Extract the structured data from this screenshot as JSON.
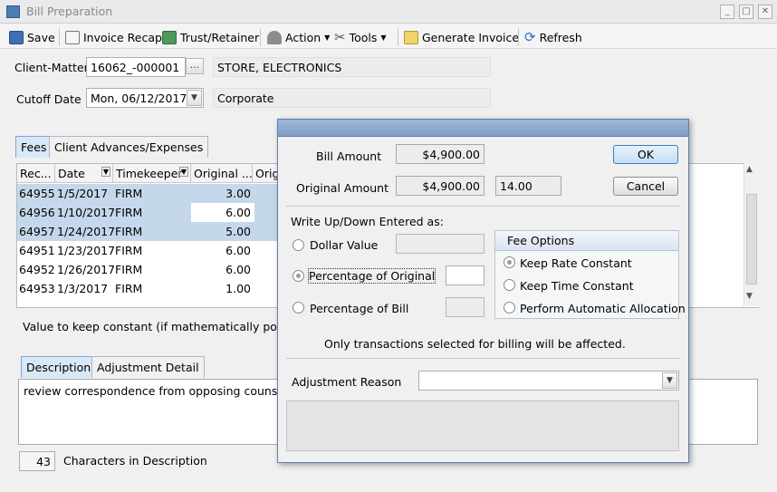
{
  "window": {
    "title": "Bill Preparation"
  },
  "toolbar": {
    "save": "Save",
    "invoice_recap": "Invoice Recap",
    "trust_retainer": "Trust/Retainer",
    "action": "Action",
    "tools": "Tools",
    "generate_invoice": "Generate Invoice",
    "refresh": "Refresh"
  },
  "header": {
    "client_matter_label": "Client-Matter",
    "client_matter_value": "16062_-000001",
    "client_name": "STORE, ELECTRONICS",
    "cutoff_label": "Cutoff Date",
    "cutoff_value": "Mon, 06/12/2017",
    "category": "Corporate",
    "browse": "..."
  },
  "tabs": {
    "fees": "Fees",
    "advances": "Client Advances/Expenses"
  },
  "grid": {
    "columns": [
      "Rec...",
      "Date",
      "Timekeeper",
      "Original ...",
      "Orig"
    ],
    "rows": [
      {
        "rec": "64955",
        "date": "1/5/2017",
        "tk": "FIRM",
        "orig": "3.00",
        "selected": true
      },
      {
        "rec": "64956",
        "date": "1/10/2017",
        "tk": "FIRM",
        "orig": "6.00",
        "selected": true
      },
      {
        "rec": "64957",
        "date": "1/24/2017",
        "tk": "FIRM",
        "orig": "5.00",
        "selected": true
      },
      {
        "rec": "64951",
        "date": "1/23/2017",
        "tk": "FIRM",
        "orig": "6.00",
        "selected": false
      },
      {
        "rec": "64952",
        "date": "1/26/2017",
        "tk": "FIRM",
        "orig": "6.00",
        "selected": false
      },
      {
        "rec": "64953",
        "date": "1/3/2017",
        "tk": "FIRM",
        "orig": "1.00",
        "selected": false
      }
    ]
  },
  "constant_note": "Value to keep constant (if mathematically possib",
  "desc_tabs": {
    "description": "Description",
    "adjustment": "Adjustment Detail"
  },
  "description": {
    "text": "review correspondence from opposing counsel",
    "count": "43",
    "count_label": "Characters in Description"
  },
  "dialog": {
    "bill_amount_label": "Bill Amount",
    "bill_amount": "$4,900.00",
    "original_amount_label": "Original Amount",
    "original_amount": "$4,900.00",
    "original_hours": "14.00",
    "ok": "OK",
    "cancel": "Cancel",
    "write_label": "Write Up/Down Entered as:",
    "opt_dollar": "Dollar Value",
    "opt_pct_original": "Percentage of Original",
    "opt_pct_bill": "Percentage of Bill",
    "fee_options_title": "Fee Options",
    "fee_rate": "Keep Rate Constant",
    "fee_time": "Keep Time Constant",
    "fee_alloc": "Perform Automatic Allocation",
    "note": "Only transactions selected for billing will be affected.",
    "reason_label": "Adjustment Reason"
  }
}
